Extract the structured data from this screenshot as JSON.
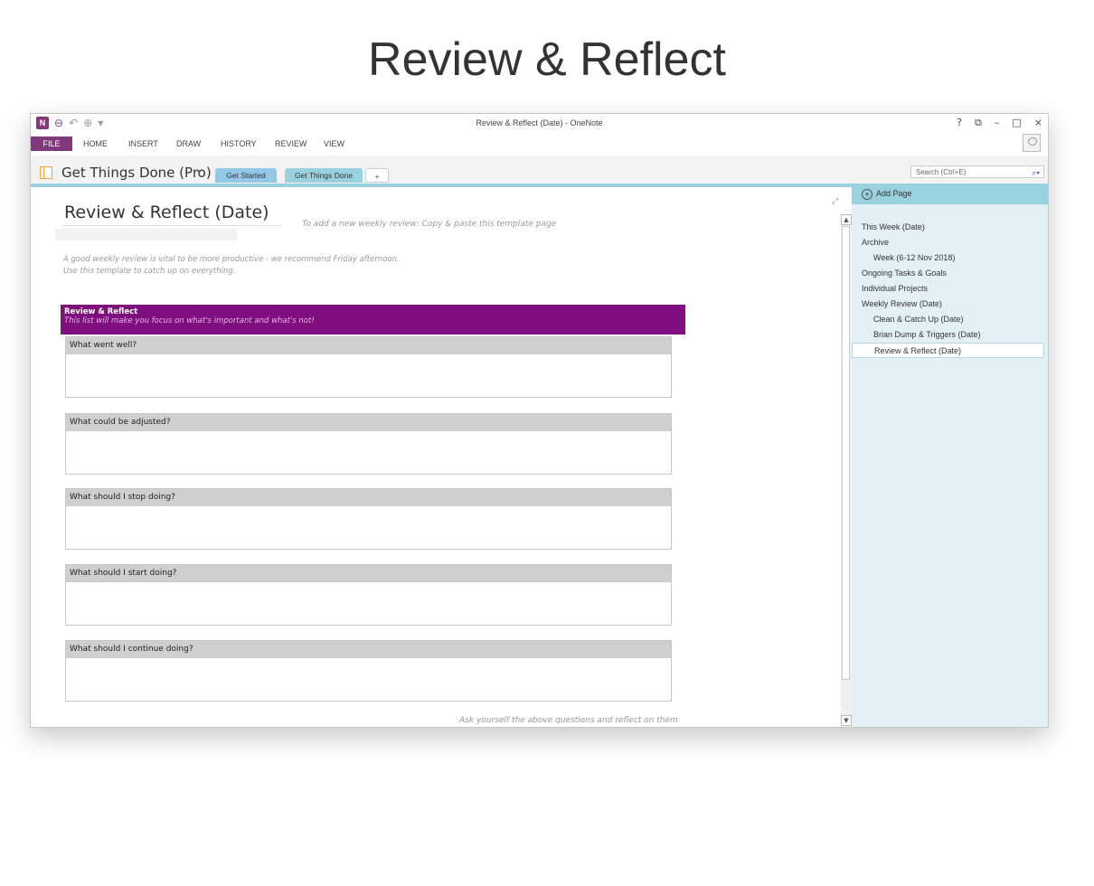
{
  "headline": "Review & Reflect",
  "window": {
    "title": "Review & Reflect (Date) - OneNote",
    "app_logo": "N",
    "controls": [
      "?",
      "⧉",
      "–",
      "□",
      "×"
    ]
  },
  "ribbon": {
    "tabs": [
      "FILE",
      "HOME",
      "INSERT",
      "DRAW",
      "HISTORY",
      "REVIEW",
      "VIEW"
    ]
  },
  "notebook": {
    "name": "Get Things Done (Pro)",
    "sections": [
      "Get Started",
      "Get Things Done",
      "+"
    ],
    "search_placeholder": "Search (Ctrl+E)"
  },
  "page": {
    "title": "Review & Reflect (Date)",
    "hint": "To add a new weekly review: Copy & paste this template page",
    "intro": [
      "A good weekly review is vital to be more productive - we recommend Friday afternoon.",
      "Use this template to catch up on everything."
    ],
    "banner_title": "Review & Reflect",
    "banner_subtitle": "This list will make you focus on what's important and what's not!",
    "questions": [
      "What went well?",
      "What could be adjusted?",
      "What should I stop doing?",
      "What should I start doing?",
      "What should I continue doing?"
    ],
    "footer": "Ask yourself  the above questions and reflect on them"
  },
  "pages_pane": {
    "add_page_label": "Add Page",
    "items": [
      {
        "label": "This Week (Date)",
        "level": 1
      },
      {
        "label": "Archive",
        "level": 1
      },
      {
        "label": "Week (6-12 Nov 2018)",
        "level": 2
      },
      {
        "label": "Ongoing Tasks & Goals",
        "level": 1
      },
      {
        "label": "Individual Projects",
        "level": 1
      },
      {
        "label": "Weekly Review (Date)",
        "level": 1
      },
      {
        "label": "Clean & Catch Up (Date)",
        "level": 2
      },
      {
        "label": "Brian Dump & Triggers (Date)",
        "level": 2
      },
      {
        "label": "Review & Reflect (Date)",
        "level": 2,
        "selected": true
      }
    ]
  },
  "colors": {
    "accent": "#80397b",
    "banner": "#7f0f7e",
    "pane": "#e3f1f6",
    "pane_header": "#9ad1df"
  }
}
